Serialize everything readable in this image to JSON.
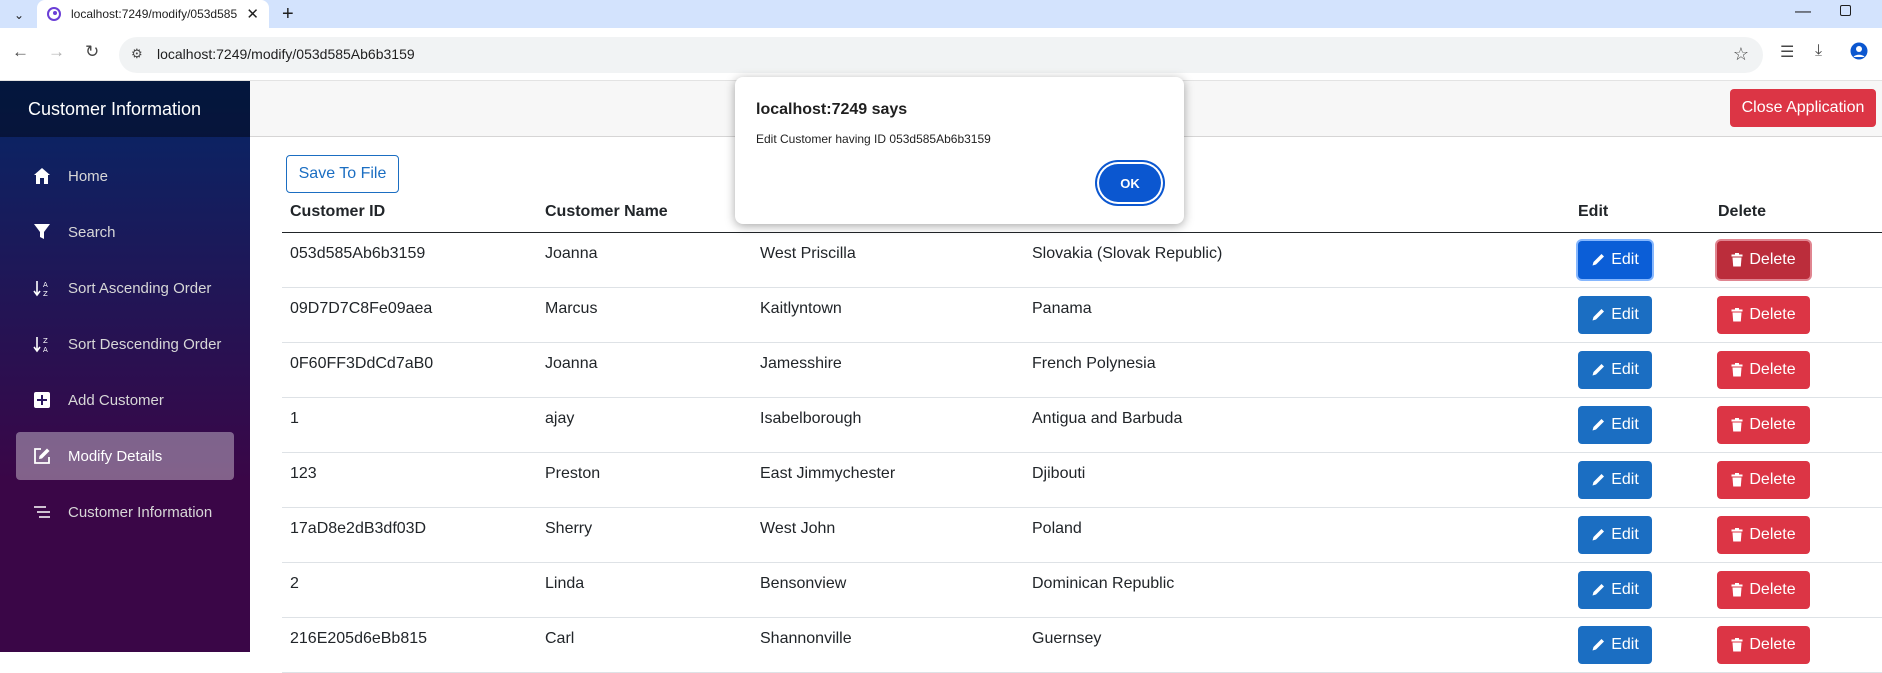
{
  "browser": {
    "tab_title": "localhost:7249/modify/053d585",
    "url": "localhost:7249/modify/053d585Ab6b3159"
  },
  "sidebar": {
    "brand": "Customer Information",
    "items": [
      {
        "label": "Home",
        "icon": "home-icon"
      },
      {
        "label": "Search",
        "icon": "filter-icon"
      },
      {
        "label": "Sort Ascending Order",
        "icon": "sort-ascending-icon"
      },
      {
        "label": "Sort Descending Order",
        "icon": "sort-descending-icon"
      },
      {
        "label": "Add Customer",
        "icon": "plus-square-icon"
      },
      {
        "label": "Modify Details",
        "icon": "edit-icon",
        "active": true
      },
      {
        "label": "Customer Information",
        "icon": "list-icon"
      }
    ]
  },
  "header": {
    "close_label": "Close Application"
  },
  "toolbar": {
    "save_label": "Save To File"
  },
  "table": {
    "columns": [
      "Customer ID",
      "Customer Name",
      "",
      "",
      "Edit",
      "Delete"
    ],
    "edit_label": "Edit",
    "delete_label": "Delete",
    "rows": [
      {
        "id": "053d585Ab6b3159",
        "name": "Joanna",
        "city": "West Priscilla",
        "country": "Slovakia (Slovak Republic)"
      },
      {
        "id": "09D7D7C8Fe09aea",
        "name": "Marcus",
        "city": "Kaitlyntown",
        "country": "Panama"
      },
      {
        "id": "0F60FF3DdCd7aB0",
        "name": "Joanna",
        "city": "Jamesshire",
        "country": "French Polynesia"
      },
      {
        "id": "1",
        "name": "ajay",
        "city": "Isabelborough",
        "country": "Antigua and Barbuda"
      },
      {
        "id": "123",
        "name": "Preston",
        "city": "East Jimmychester",
        "country": "Djibouti"
      },
      {
        "id": "17aD8e2dB3df03D",
        "name": "Sherry",
        "city": "West John",
        "country": "Poland"
      },
      {
        "id": "2",
        "name": "Linda",
        "city": "Bensonview",
        "country": "Dominican Republic"
      },
      {
        "id": "216E205d6eBb815",
        "name": "Carl",
        "city": "Shannonville",
        "country": "Guernsey"
      }
    ]
  },
  "dialog": {
    "title": "localhost:7249 says",
    "message": "Edit Customer having ID 053d585Ab6b3159",
    "ok_label": "OK"
  },
  "colors": {
    "primary": "#1b6ec2",
    "danger": "#dc3545",
    "dialog_button": "#0b57d0"
  }
}
